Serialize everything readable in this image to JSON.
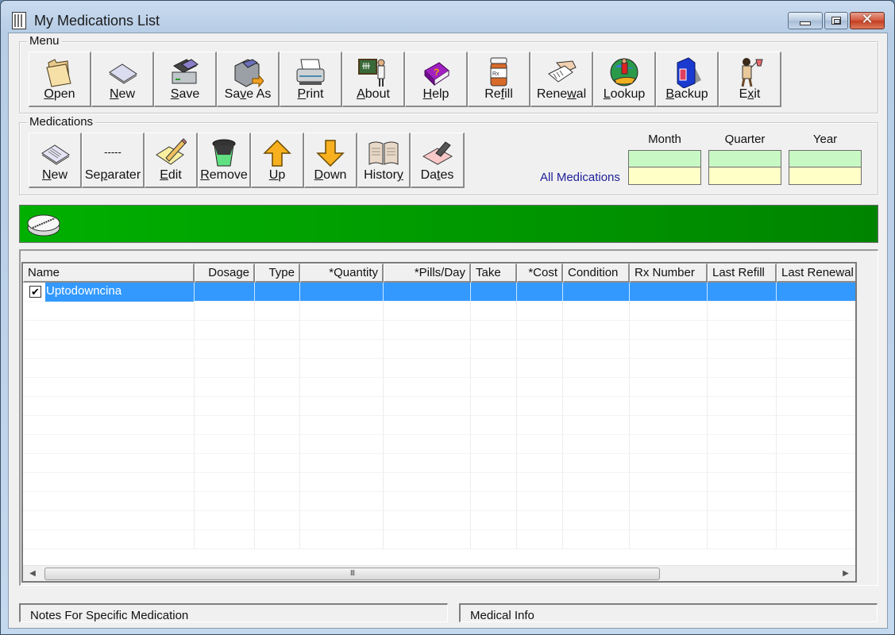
{
  "window": {
    "title": "My Medications List",
    "close_glyph": "✕"
  },
  "menu_group": {
    "legend": "Menu",
    "buttons": [
      {
        "id": "open",
        "label": "Open",
        "icon": "folder-icon"
      },
      {
        "id": "new",
        "label": "New",
        "icon": "blank-paper-icon"
      },
      {
        "id": "save",
        "label": "Save",
        "icon": "save-disk-icon"
      },
      {
        "id": "save-as",
        "label": "Save As",
        "icon": "save-as-icon"
      },
      {
        "id": "print",
        "label": "Print",
        "icon": "printer-icon"
      },
      {
        "id": "about",
        "label": "About",
        "icon": "teacher-chalkboard-icon"
      },
      {
        "id": "help",
        "label": "Help",
        "icon": "help-book-icon"
      },
      {
        "id": "refill",
        "label": "Refill",
        "icon": "pill-bottle-icon"
      },
      {
        "id": "renewal",
        "label": "Renewal",
        "icon": "hand-prescription-icon"
      },
      {
        "id": "lookup",
        "label": "Lookup",
        "icon": "globe-surfer-icon"
      },
      {
        "id": "backup",
        "label": "Backup",
        "icon": "server-cabinet-icon"
      },
      {
        "id": "exit",
        "label": "Exit",
        "icon": "traveler-icon"
      }
    ]
  },
  "medications_group": {
    "legend": "Medications",
    "buttons": [
      {
        "id": "new",
        "label": "New",
        "icon": "document-icon"
      },
      {
        "id": "separater",
        "label": "Separater",
        "icon": "dashes-icon",
        "glyph": "-----"
      },
      {
        "id": "edit",
        "label": "Edit",
        "icon": "pencil-paper-icon"
      },
      {
        "id": "remove",
        "label": "Remove",
        "icon": "trash-bin-icon"
      },
      {
        "id": "up",
        "label": "Up",
        "icon": "arrow-up-icon"
      },
      {
        "id": "down",
        "label": "Down",
        "icon": "arrow-down-icon"
      },
      {
        "id": "history",
        "label": "History",
        "icon": "open-book-icon"
      },
      {
        "id": "dates",
        "label": "Dates",
        "icon": "calendar-stamp-icon"
      }
    ],
    "stats": {
      "row_label": "All Medications",
      "columns": [
        {
          "label": "Month",
          "top_value": "",
          "bottom_value": ""
        },
        {
          "label": "Quarter",
          "top_value": "",
          "bottom_value": ""
        },
        {
          "label": "Year",
          "top_value": "",
          "bottom_value": ""
        }
      ]
    }
  },
  "banner": {
    "icon": "pill-tablet-icon",
    "color": "#00a000"
  },
  "medication_table": {
    "columns": [
      "Name",
      "Dosage",
      "Type",
      "*Quantity",
      "*Pills/Day",
      "Take",
      "*Cost",
      "Condition",
      "Rx Number",
      "Last Refill",
      "Last Renewal"
    ],
    "rows": [
      {
        "checked": true,
        "selected": true,
        "cells": [
          "Uptodowncina",
          "",
          "",
          "",
          "",
          "",
          "",
          "",
          "",
          "",
          ""
        ]
      }
    ],
    "selection_color": "#3399ff",
    "scroll_grip": "III"
  },
  "bottom": {
    "notes_label": "Notes For Specific Medication",
    "medical_info_label": "Medical Info"
  }
}
